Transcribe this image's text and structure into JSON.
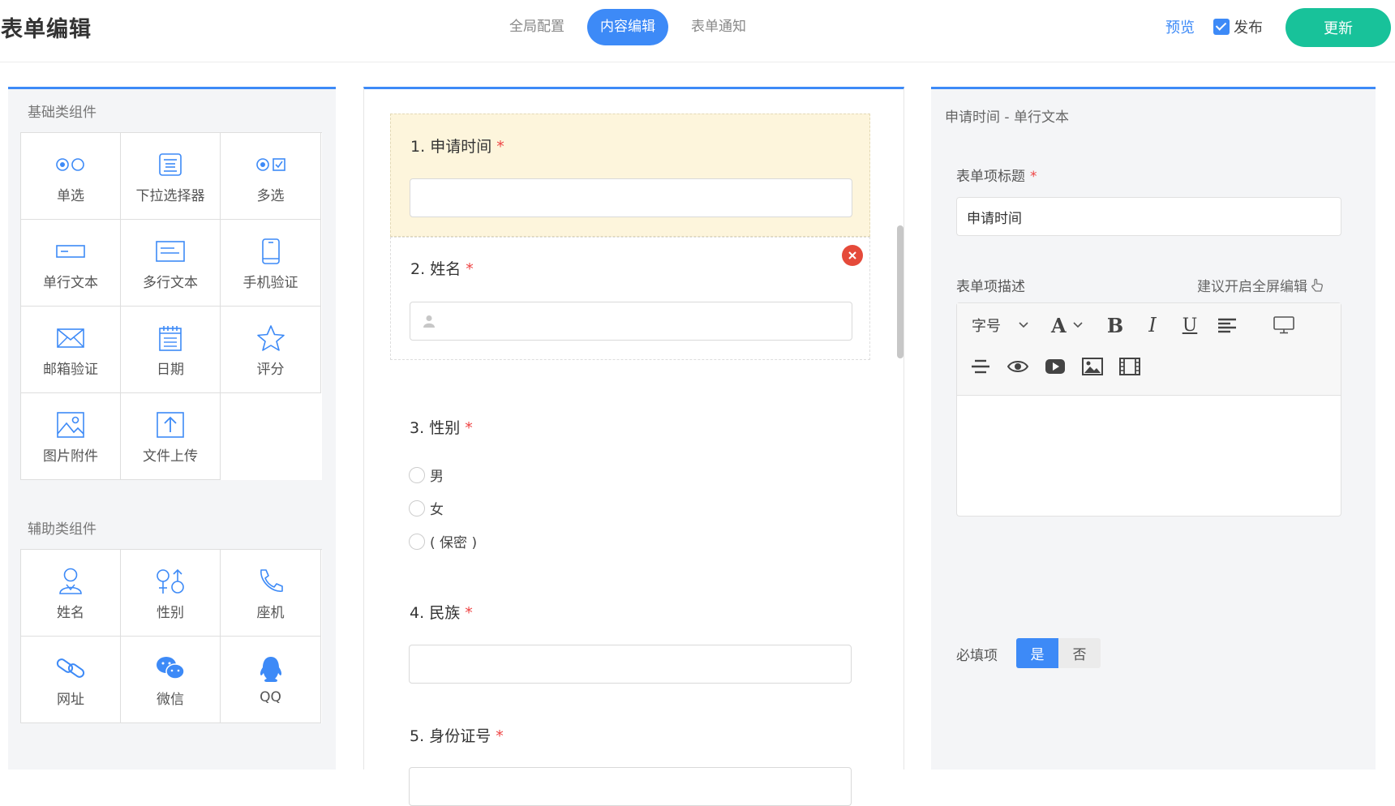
{
  "header": {
    "title": "表单编辑",
    "tabs": [
      {
        "label": "全局配置",
        "active": false
      },
      {
        "label": "内容编辑",
        "active": true
      },
      {
        "label": "表单通知",
        "active": false
      }
    ],
    "preview_label": "预览",
    "publish_label": "发布",
    "publish_checked": true,
    "update_label": "更新"
  },
  "components": {
    "basic_title": "基础类组件",
    "basic": [
      {
        "label": "单选",
        "icon": "radio-icon"
      },
      {
        "label": "下拉选择器",
        "icon": "dropdown-icon"
      },
      {
        "label": "多选",
        "icon": "checkbox-icon"
      },
      {
        "label": "单行文本",
        "icon": "single-line-text-icon"
      },
      {
        "label": "多行文本",
        "icon": "multi-line-text-icon"
      },
      {
        "label": "手机验证",
        "icon": "phone-icon"
      },
      {
        "label": "邮箱验证",
        "icon": "email-icon"
      },
      {
        "label": "日期",
        "icon": "calendar-icon"
      },
      {
        "label": "评分",
        "icon": "star-icon"
      },
      {
        "label": "图片附件",
        "icon": "image-icon"
      },
      {
        "label": "文件上传",
        "icon": "upload-icon"
      }
    ],
    "aux_title": "辅助类组件",
    "aux": [
      {
        "label": "姓名",
        "icon": "person-icon"
      },
      {
        "label": "性别",
        "icon": "gender-icon"
      },
      {
        "label": "座机",
        "icon": "telephone-icon"
      },
      {
        "label": "网址",
        "icon": "link-icon"
      },
      {
        "label": "微信",
        "icon": "wechat-icon"
      },
      {
        "label": "QQ",
        "icon": "qq-icon"
      }
    ]
  },
  "form": {
    "questions": [
      {
        "number": "1.",
        "label": "申请时间",
        "required": true,
        "type": "text"
      },
      {
        "number": "2.",
        "label": "姓名",
        "required": true,
        "type": "text"
      },
      {
        "number": "3.",
        "label": "性别",
        "required": true,
        "type": "radio",
        "options": [
          "男",
          "女",
          "( 保密 )"
        ]
      },
      {
        "number": "4.",
        "label": "民族",
        "required": true,
        "type": "text"
      },
      {
        "number": "5.",
        "label": "身份证号",
        "required": true,
        "type": "text"
      }
    ],
    "required_mark": "*"
  },
  "properties": {
    "header": "申请时间 - 单行文本",
    "title_label": "表单项标题",
    "title_value": "申请时间",
    "desc_label": "表单项描述",
    "fullscreen_hint": "建议开启全屏编辑",
    "toolbar": {
      "font_size": "字号",
      "font_color": "A",
      "bold": "B",
      "italic": "I",
      "underline": "U"
    },
    "required_label": "必填项",
    "required_yes": "是",
    "required_no": "否",
    "required_value": "是"
  },
  "colors": {
    "accent": "#3d8af7",
    "update": "#18c29a",
    "delete": "#e54a3a",
    "selected_bg": "#fdf5dc"
  }
}
